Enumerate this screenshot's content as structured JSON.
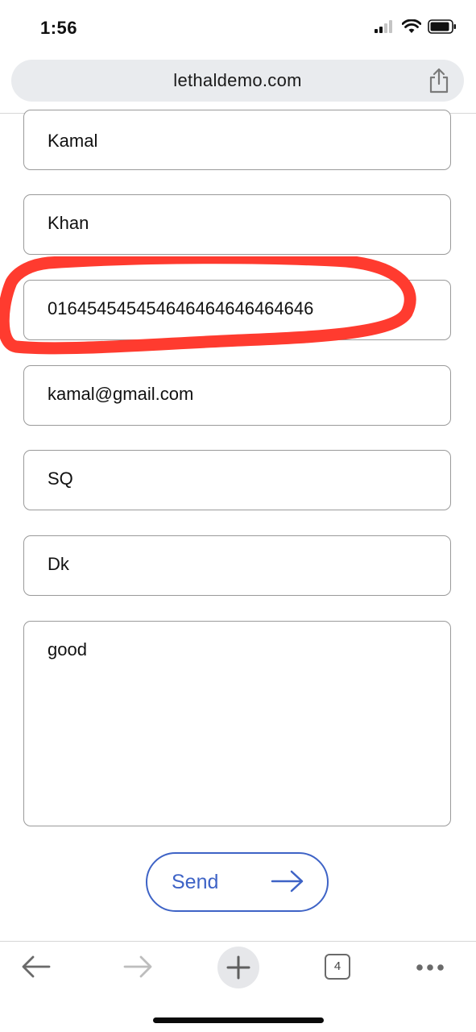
{
  "status_bar": {
    "time": "1:56",
    "icons": [
      "signal-icon",
      "wifi-icon",
      "battery-icon"
    ]
  },
  "browser": {
    "url": "lethaldemo.com",
    "share_icon": "share-icon"
  },
  "form": {
    "fields": [
      {
        "value": "Kamal"
      },
      {
        "value": "Khan"
      },
      {
        "value": "016454545454646464646464646"
      },
      {
        "value": "kamal@gmail.com"
      },
      {
        "value": "SQ"
      },
      {
        "value": "Dk"
      }
    ],
    "message": {
      "value": "good"
    },
    "send_label": "Send"
  },
  "annotation": {
    "color": "#ff3b2f",
    "shape": "hand-drawn circle around phone field"
  },
  "toolbar": {
    "icons": [
      "back-arrow-icon",
      "forward-arrow-icon",
      "plus-icon",
      "tabs-icon",
      "more-icon"
    ],
    "tab_count": "4"
  },
  "colors": {
    "accent": "#3e63c6",
    "url_bar_bg": "#e9ebee",
    "annotation": "#ff3b2f"
  }
}
